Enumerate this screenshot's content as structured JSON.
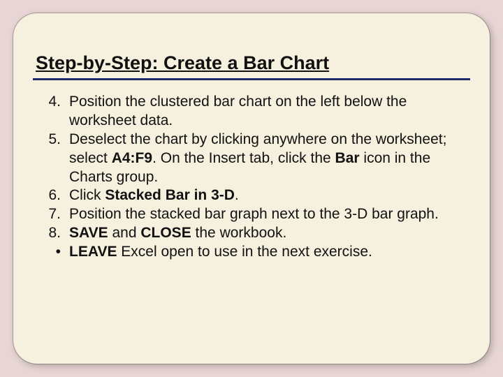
{
  "title": "Step-by-Step: Create a Bar Chart",
  "items": [
    {
      "marker": "4.",
      "segments": [
        {
          "t": "Position the clustered bar chart on the left below the worksheet data."
        }
      ]
    },
    {
      "marker": "5.",
      "segments": [
        {
          "t": "Deselect the chart by clicking anywhere on the worksheet; select "
        },
        {
          "t": "A4:F9",
          "b": true
        },
        {
          "t": ". On the Insert tab, click the "
        },
        {
          "t": "Bar",
          "b": true
        },
        {
          "t": " icon in the Charts group."
        }
      ]
    },
    {
      "marker": "6.",
      "segments": [
        {
          "t": "Click "
        },
        {
          "t": "Stacked Bar in 3-D",
          "b": true
        },
        {
          "t": "."
        }
      ]
    },
    {
      "marker": "7.",
      "segments": [
        {
          "t": "Position the stacked bar graph next to the 3-D bar graph."
        }
      ]
    },
    {
      "marker": "8.",
      "segments": [
        {
          "t": "SAVE",
          "b": true
        },
        {
          "t": " and "
        },
        {
          "t": "CLOSE",
          "b": true
        },
        {
          "t": " the workbook."
        }
      ]
    },
    {
      "marker": "•",
      "segments": [
        {
          "t": "LEAVE",
          "b": true
        },
        {
          "t": " Excel open to use in the next exercise."
        }
      ]
    }
  ]
}
